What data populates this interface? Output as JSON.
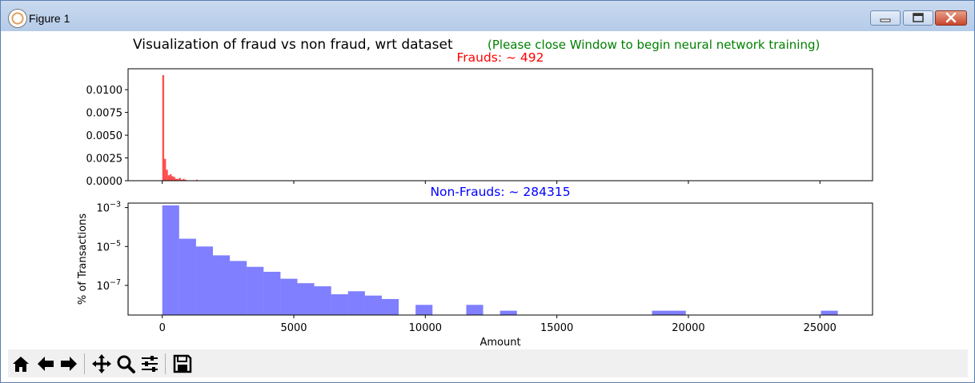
{
  "window": {
    "title": "Figure 1",
    "icon": "matplotlib-figure-icon",
    "buttons": [
      "minimize-icon",
      "maximize-icon",
      "close-icon"
    ]
  },
  "figure": {
    "suptitle": "Visualization of fraud vs non fraud, wrt dataset",
    "notice": "(Please close Window to begin neural network training)",
    "notice_color": "#008000"
  },
  "toolbar": {
    "icons": [
      "home-icon",
      "back-icon",
      "forward-icon",
      "pan-icon",
      "zoom-icon",
      "configure-subplots-icon",
      "save-icon"
    ]
  },
  "chart_data": [
    {
      "type": "bar",
      "title": "Frauds: ~ 492",
      "title_color": "#ff0000",
      "color": "#ff0000",
      "alpha": 0.7,
      "xlim": [
        -1300,
        27000
      ],
      "ylim": [
        0,
        0.0123
      ],
      "yscale": "linear",
      "yticks": [
        0.0,
        0.0025,
        0.005,
        0.0075,
        0.01
      ],
      "ytick_labels": [
        "0.0000",
        "0.0025",
        "0.0050",
        "0.0075",
        "0.0100"
      ],
      "xticks": [
        0,
        5000,
        10000,
        15000,
        20000,
        25000
      ],
      "show_xtick_labels": false,
      "bins": [
        {
          "x0": 0,
          "x1": 71,
          "value": 0.0116
        },
        {
          "x0": 71,
          "x1": 142,
          "value": 0.0024
        },
        {
          "x0": 142,
          "x1": 213,
          "value": 0.0012
        },
        {
          "x0": 213,
          "x1": 284,
          "value": 0.0006
        },
        {
          "x0": 284,
          "x1": 355,
          "value": 0.0007
        },
        {
          "x0": 355,
          "x1": 426,
          "value": 0.0005
        },
        {
          "x0": 426,
          "x1": 497,
          "value": 0.0004
        },
        {
          "x0": 497,
          "x1": 568,
          "value": 0.0002
        },
        {
          "x0": 568,
          "x1": 639,
          "value": 0.0002
        },
        {
          "x0": 639,
          "x1": 710,
          "value": 0.0003
        },
        {
          "x0": 710,
          "x1": 781,
          "value": 0.0001
        },
        {
          "x0": 781,
          "x1": 852,
          "value": 0.0002
        },
        {
          "x0": 852,
          "x1": 923,
          "value": 0.0001
        },
        {
          "x0": 1278,
          "x1": 1349,
          "value": 0.0001
        }
      ]
    },
    {
      "type": "bar",
      "title": "Non-Frauds: ~ 284315",
      "title_color": "#0000ff",
      "color": "#0000ff",
      "alpha": 0.5,
      "xlim": [
        -1300,
        27000
      ],
      "ylim": [
        3e-09,
        0.0017
      ],
      "yscale": "log",
      "ylabel": "% of Transactions",
      "xlabel": "Amount",
      "yticks": [
        1e-07,
        1e-05,
        0.001
      ],
      "ytick_labels": [
        [
          "10",
          "−7"
        ],
        [
          "10",
          "−5"
        ],
        [
          "10",
          "−3"
        ]
      ],
      "xticks": [
        0,
        5000,
        10000,
        15000,
        20000,
        25000
      ],
      "xtick_labels": [
        "0",
        "5000",
        "10000",
        "15000",
        "20000",
        "25000"
      ],
      "bins": [
        {
          "x0": 0,
          "x1": 642,
          "value": 0.0013
        },
        {
          "x0": 642,
          "x1": 1284,
          "value": 2.5e-05
        },
        {
          "x0": 1284,
          "x1": 1926,
          "value": 1e-05
        },
        {
          "x0": 1926,
          "x1": 2568,
          "value": 3.5e-06
        },
        {
          "x0": 2568,
          "x1": 3210,
          "value": 1.8e-06
        },
        {
          "x0": 3210,
          "x1": 3852,
          "value": 9e-07
        },
        {
          "x0": 3852,
          "x1": 4494,
          "value": 5e-07
        },
        {
          "x0": 4494,
          "x1": 5136,
          "value": 2.2e-07
        },
        {
          "x0": 5136,
          "x1": 5778,
          "value": 1.3e-07
        },
        {
          "x0": 5778,
          "x1": 6420,
          "value": 9e-08
        },
        {
          "x0": 6420,
          "x1": 7062,
          "value": 3.5e-08
        },
        {
          "x0": 7062,
          "x1": 7704,
          "value": 5e-08
        },
        {
          "x0": 7704,
          "x1": 8346,
          "value": 3e-08
        },
        {
          "x0": 8346,
          "x1": 8988,
          "value": 2e-08
        },
        {
          "x0": 9630,
          "x1": 10272,
          "value": 1e-08
        },
        {
          "x0": 11556,
          "x1": 12198,
          "value": 1e-08
        },
        {
          "x0": 12840,
          "x1": 13482,
          "value": 5e-09
        },
        {
          "x0": 18618,
          "x1": 19902,
          "value": 5e-09
        },
        {
          "x0": 25038,
          "x1": 25680,
          "value": 5e-09
        }
      ]
    }
  ]
}
